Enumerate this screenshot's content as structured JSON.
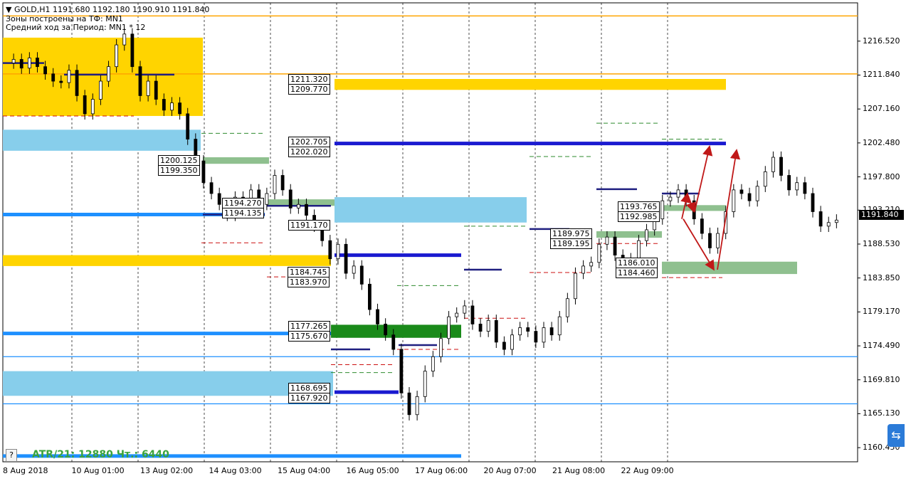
{
  "header": {
    "symbol_line": "▼ GOLD,H1  1191.680 1192.180 1190.910 1191.840",
    "line2": "Зоны построены на ТФ: MN1",
    "line3": "Средний ход за Период: MN1 * 12"
  },
  "current_price": "1191.840",
  "atr_text": "ATR/21: 12880  Чт.: 6440",
  "help_label": "?",
  "side_button_icon": "teamviewer-icon",
  "chart_data": {
    "type": "candlestick",
    "symbol": "GOLD",
    "timeframe": "H1",
    "ylim": [
      1158.5,
      1221.8
    ],
    "y_ticks": [
      "1216.520",
      "1211.840",
      "1207.160",
      "1202.480",
      "1197.800",
      "1193.210",
      "1188.530",
      "1183.850",
      "1179.170",
      "1174.490",
      "1169.810",
      "1165.130",
      "1160.450"
    ],
    "x_ticks": [
      "8 Aug 2018",
      "10 Aug 01:00",
      "13 Aug 02:00",
      "14 Aug 03:00",
      "15 Aug 04:00",
      "16 Aug 05:00",
      "17 Aug 06:00",
      "20 Aug 07:00",
      "21 Aug 08:00",
      "22 Aug 09:00"
    ],
    "close_path": [
      [
        0,
        1213.5
      ],
      [
        0.3,
        1214.0
      ],
      [
        0.6,
        1212.8
      ],
      [
        0.9,
        1214.2
      ],
      [
        1.2,
        1213.0
      ],
      [
        1.5,
        1212.0
      ],
      [
        1.8,
        1211.0
      ],
      [
        2.1,
        1210.8
      ],
      [
        2.4,
        1212.5
      ],
      [
        2.7,
        1209.0
      ],
      [
        3.0,
        1206.5
      ],
      [
        3.3,
        1208.5
      ],
      [
        3.6,
        1211.0
      ],
      [
        3.9,
        1213.0
      ],
      [
        4.2,
        1216.0
      ],
      [
        4.5,
        1217.5
      ],
      [
        4.8,
        1213.0
      ],
      [
        5.1,
        1209.0
      ],
      [
        5.4,
        1211.0
      ],
      [
        5.7,
        1208.5
      ],
      [
        6.0,
        1207.0
      ],
      [
        6.3,
        1208.0
      ],
      [
        6.6,
        1206.5
      ],
      [
        6.9,
        1203.0
      ],
      [
        7.2,
        1200.0
      ],
      [
        7.5,
        1197.0
      ],
      [
        7.8,
        1195.5
      ],
      [
        8.1,
        1194.0
      ],
      [
        8.4,
        1192.5
      ],
      [
        8.7,
        1195.0
      ],
      [
        9.0,
        1193.5
      ],
      [
        9.3,
        1196.0
      ],
      [
        9.6,
        1194.0
      ],
      [
        9.9,
        1195.5
      ],
      [
        10.2,
        1198.0
      ],
      [
        10.5,
        1196.0
      ],
      [
        10.8,
        1193.5
      ],
      [
        11.1,
        1194.0
      ],
      [
        11.4,
        1192.5
      ],
      [
        11.7,
        1191.0
      ],
      [
        12.0,
        1189.0
      ],
      [
        12.3,
        1186.5
      ],
      [
        12.6,
        1188.5
      ],
      [
        12.9,
        1184.5
      ],
      [
        13.2,
        1185.5
      ],
      [
        13.5,
        1183.0
      ],
      [
        13.8,
        1179.5
      ],
      [
        14.1,
        1177.5
      ],
      [
        14.4,
        1176.0
      ],
      [
        14.7,
        1174.0
      ],
      [
        15.0,
        1168.0
      ],
      [
        15.3,
        1165.0
      ],
      [
        15.6,
        1167.5
      ],
      [
        15.9,
        1171.0
      ],
      [
        16.2,
        1173.0
      ],
      [
        16.5,
        1175.5
      ],
      [
        16.8,
        1178.5
      ],
      [
        17.1,
        1179.0
      ],
      [
        17.4,
        1180.0
      ],
      [
        17.7,
        1177.5
      ],
      [
        18.0,
        1176.5
      ],
      [
        18.3,
        1178.0
      ],
      [
        18.6,
        1175.0
      ],
      [
        18.9,
        1174.0
      ],
      [
        19.2,
        1176.0
      ],
      [
        19.5,
        1177.0
      ],
      [
        19.8,
        1176.5
      ],
      [
        20.1,
        1175.0
      ],
      [
        20.4,
        1177.0
      ],
      [
        20.7,
        1176.0
      ],
      [
        21.0,
        1178.5
      ],
      [
        21.3,
        1181.0
      ],
      [
        21.6,
        1184.5
      ],
      [
        21.9,
        1185.5
      ],
      [
        22.2,
        1186.0
      ],
      [
        22.5,
        1188.5
      ],
      [
        22.8,
        1189.5
      ],
      [
        23.1,
        1187.0
      ],
      [
        23.4,
        1185.0
      ],
      [
        23.7,
        1186.5
      ],
      [
        24.0,
        1189.0
      ],
      [
        24.3,
        1190.5
      ],
      [
        24.6,
        1192.0
      ],
      [
        24.9,
        1194.5
      ],
      [
        25.2,
        1195.0
      ],
      [
        25.5,
        1196.0
      ],
      [
        25.8,
        1194.5
      ],
      [
        26.1,
        1192.0
      ],
      [
        26.4,
        1190.0
      ],
      [
        26.7,
        1188.0
      ],
      [
        27.0,
        1190.0
      ],
      [
        27.3,
        1193.0
      ],
      [
        27.6,
        1196.0
      ],
      [
        27.9,
        1195.5
      ],
      [
        28.2,
        1194.5
      ],
      [
        28.5,
        1196.5
      ],
      [
        28.8,
        1198.5
      ],
      [
        29.1,
        1200.5
      ],
      [
        29.4,
        1198.0
      ],
      [
        29.7,
        1196.0
      ],
      [
        30.0,
        1197.0
      ],
      [
        30.3,
        1195.5
      ],
      [
        30.6,
        1193.0
      ],
      [
        30.9,
        1191.0
      ],
      [
        31.2,
        1191.5
      ],
      [
        31.5,
        1191.84
      ]
    ],
    "zones": [
      {
        "type": "resistance",
        "upper": 1211.32,
        "lower": 1209.77,
        "upper_label": "1211.320",
        "lower_label": "1209.770",
        "color": "#FFD400"
      },
      {
        "type": "level",
        "upper": 1202.705,
        "lower": 1202.02,
        "upper_label": "1202.705",
        "lower_label": "1202.020",
        "color": "#1020C0"
      },
      {
        "type": "level",
        "value": 1191.17,
        "label": "1191.170"
      },
      {
        "type": "level",
        "upper": 1177.265,
        "lower": 1175.67,
        "upper_label": "1177.265",
        "lower_label": "1175.670"
      },
      {
        "type": "level",
        "upper": 1168.695,
        "lower": 1167.92,
        "upper_label": "1168.695",
        "lower_label": "1167.920"
      },
      {
        "type": "support",
        "upper": 1186.01,
        "lower": 1184.46,
        "upper_label": "1186.010",
        "lower_label": "1184.460",
        "color": "#8FC08F"
      },
      {
        "type": "level",
        "upper": 1193.765,
        "lower": 1192.985,
        "upper_label": "1193.765",
        "lower_label": "1192.985"
      },
      {
        "type": "level",
        "upper": 1189.975,
        "lower": 1189.195,
        "upper_label": "1189.975",
        "lower_label": "1189.195"
      },
      {
        "type": "level",
        "upper": 1194.27,
        "lower": 1194.135,
        "upper_label": "1194.270",
        "lower_label": "1194.135"
      },
      {
        "type": "level",
        "upper": 1200.125,
        "lower": 1199.35,
        "upper_label": "1200.125",
        "lower_label": "1199.350"
      },
      {
        "type": "level",
        "upper": 1184.745,
        "lower": 1183.97,
        "upper_label": "1184.745",
        "lower_label": "1183.970"
      }
    ],
    "colors": {
      "gold_zone": "#FFD400",
      "blue_zone": "#87CEEB",
      "green_zone": "#8FC08F",
      "dark_green": "#1A8A1A",
      "navy": "#1F1F80",
      "royal_blue": "#1A1AD0",
      "bright_blue": "#1E90FF",
      "orange_line": "#FFA500",
      "red_dash": "#CC1010",
      "green_dash": "#2E8B2E",
      "arrow": "#C01818"
    }
  }
}
